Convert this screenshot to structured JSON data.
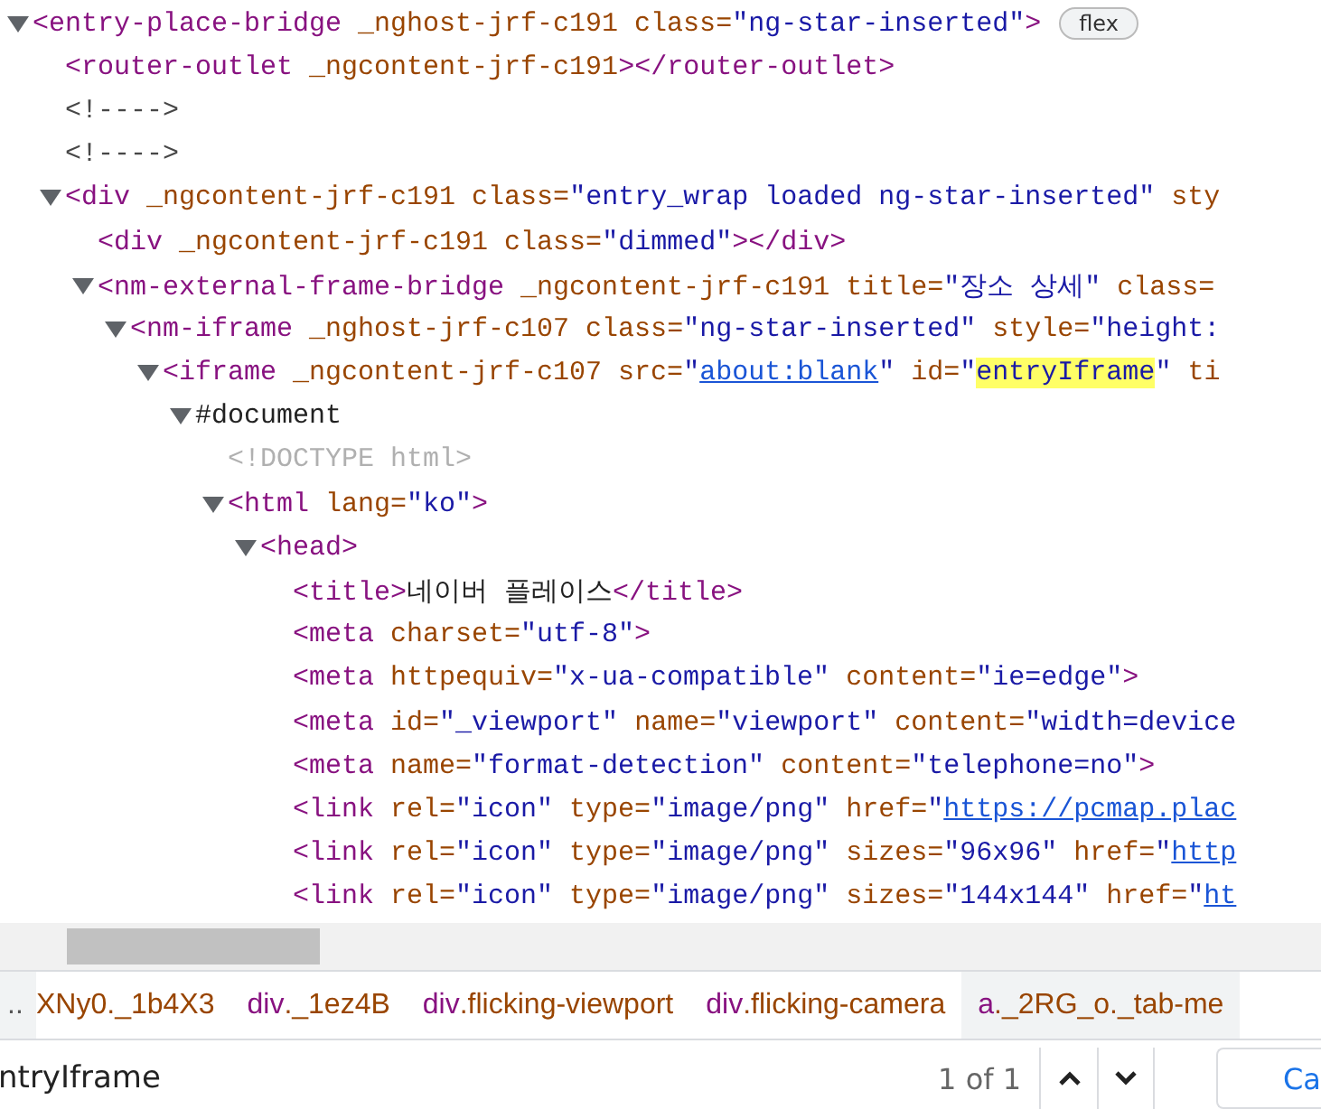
{
  "dom_tree": {
    "nodes": [
      {
        "kind": "parent",
        "expanded": true,
        "tokens": [
          {
            "kind": "tag",
            "text": "<entry-place-bridge "
          },
          {
            "kind": "attr",
            "text": "_nghost-jrf-c191 class="
          },
          {
            "kind": "value",
            "text": "\"ng-star-inserted\""
          },
          {
            "kind": "tag",
            "text": ">"
          }
        ],
        "badge": "flex",
        "children": [
          {
            "kind": "leaf",
            "tokens": [
              {
                "kind": "tag",
                "text": "<router-outlet "
              },
              {
                "kind": "attr",
                "text": "_ngcontent-jrf-c191"
              },
              {
                "kind": "tag",
                "text": "></router-outlet>"
              }
            ]
          },
          {
            "kind": "leaf",
            "tokens": [
              {
                "kind": "comment",
                "text": "<!---->"
              }
            ]
          },
          {
            "kind": "leaf",
            "tokens": [
              {
                "kind": "comment",
                "text": "<!---->"
              }
            ]
          },
          {
            "kind": "parent",
            "expanded": true,
            "tokens": [
              {
                "kind": "tag",
                "text": "<div "
              },
              {
                "kind": "attr",
                "text": "_ngcontent-jrf-c191 class="
              },
              {
                "kind": "value",
                "text": "\"entry_wrap loaded ng-star-inserted\""
              },
              {
                "kind": "attr",
                "text": " sty"
              }
            ],
            "children": [
              {
                "kind": "leaf",
                "tokens": [
                  {
                    "kind": "tag",
                    "text": "<div "
                  },
                  {
                    "kind": "attr",
                    "text": "_ngcontent-jrf-c191 class="
                  },
                  {
                    "kind": "value",
                    "text": "\"dimmed\""
                  },
                  {
                    "kind": "tag",
                    "text": "></div>"
                  }
                ]
              },
              {
                "kind": "parent",
                "expanded": true,
                "tokens": [
                  {
                    "kind": "tag",
                    "text": "<nm-external-frame-bridge "
                  },
                  {
                    "kind": "attr",
                    "text": "_ngcontent-jrf-c191 title="
                  },
                  {
                    "kind": "value",
                    "text": "\"장소 상세\""
                  },
                  {
                    "kind": "attr",
                    "text": " class="
                  }
                ],
                "children": [
                  {
                    "kind": "parent",
                    "expanded": true,
                    "tokens": [
                      {
                        "kind": "tag",
                        "text": "<nm-iframe "
                      },
                      {
                        "kind": "attr",
                        "text": "_nghost-jrf-c107 class="
                      },
                      {
                        "kind": "value",
                        "text": "\"ng-star-inserted\""
                      },
                      {
                        "kind": "attr",
                        "text": " style="
                      },
                      {
                        "kind": "value",
                        "text": "\"height:"
                      }
                    ],
                    "children": [
                      {
                        "kind": "parent",
                        "expanded": true,
                        "tokens": [
                          {
                            "kind": "tag",
                            "text": "<iframe "
                          },
                          {
                            "kind": "attr",
                            "text": "_ngcontent-jrf-c107 src="
                          },
                          {
                            "kind": "value",
                            "text": "\""
                          },
                          {
                            "kind": "link",
                            "text": "about:blank"
                          },
                          {
                            "kind": "value",
                            "text": "\""
                          },
                          {
                            "kind": "attr",
                            "text": " id="
                          },
                          {
                            "kind": "value",
                            "text": "\""
                          },
                          {
                            "kind": "match",
                            "text": "entryIframe"
                          },
                          {
                            "kind": "value",
                            "text": "\""
                          },
                          {
                            "kind": "attr",
                            "text": " ti"
                          }
                        ],
                        "children": [
                          {
                            "kind": "parent",
                            "expanded": true,
                            "tokens": [
                              {
                                "kind": "text",
                                "text": "#document"
                              }
                            ],
                            "children": [
                              {
                                "kind": "leaf",
                                "tokens": [
                                  {
                                    "kind": "doctype",
                                    "text": "<!DOCTYPE html>"
                                  }
                                ]
                              },
                              {
                                "kind": "parent",
                                "expanded": true,
                                "tokens": [
                                  {
                                    "kind": "tag",
                                    "text": "<html "
                                  },
                                  {
                                    "kind": "attr",
                                    "text": "lang="
                                  },
                                  {
                                    "kind": "value",
                                    "text": "\"ko\""
                                  },
                                  {
                                    "kind": "tag",
                                    "text": ">"
                                  }
                                ],
                                "children": [
                                  {
                                    "kind": "parent",
                                    "expanded": true,
                                    "tokens": [
                                      {
                                        "kind": "tag",
                                        "text": "<head>"
                                      }
                                    ],
                                    "children": [
                                      {
                                        "kind": "leaf",
                                        "tokens": [
                                          {
                                            "kind": "tag",
                                            "text": "<title>"
                                          },
                                          {
                                            "kind": "text",
                                            "text": "네이버 플레이스"
                                          },
                                          {
                                            "kind": "tag",
                                            "text": "</title>"
                                          }
                                        ]
                                      },
                                      {
                                        "kind": "leaf",
                                        "tokens": [
                                          {
                                            "kind": "tag",
                                            "text": "<meta "
                                          },
                                          {
                                            "kind": "attr",
                                            "text": "charset="
                                          },
                                          {
                                            "kind": "value",
                                            "text": "\"utf-8\""
                                          },
                                          {
                                            "kind": "tag",
                                            "text": ">"
                                          }
                                        ]
                                      },
                                      {
                                        "kind": "leaf",
                                        "tokens": [
                                          {
                                            "kind": "tag",
                                            "text": "<meta "
                                          },
                                          {
                                            "kind": "attr",
                                            "text": "httpequiv="
                                          },
                                          {
                                            "kind": "value",
                                            "text": "\"x-ua-compatible\""
                                          },
                                          {
                                            "kind": "attr",
                                            "text": " content="
                                          },
                                          {
                                            "kind": "value",
                                            "text": "\"ie=edge\""
                                          },
                                          {
                                            "kind": "tag",
                                            "text": ">"
                                          }
                                        ]
                                      },
                                      {
                                        "kind": "leaf",
                                        "tokens": [
                                          {
                                            "kind": "tag",
                                            "text": "<meta "
                                          },
                                          {
                                            "kind": "attr",
                                            "text": "id="
                                          },
                                          {
                                            "kind": "value",
                                            "text": "\"_viewport\""
                                          },
                                          {
                                            "kind": "attr",
                                            "text": " name="
                                          },
                                          {
                                            "kind": "value",
                                            "text": "\"viewport\""
                                          },
                                          {
                                            "kind": "attr",
                                            "text": " content="
                                          },
                                          {
                                            "kind": "value",
                                            "text": "\"width=device"
                                          }
                                        ]
                                      },
                                      {
                                        "kind": "leaf",
                                        "tokens": [
                                          {
                                            "kind": "tag",
                                            "text": "<meta "
                                          },
                                          {
                                            "kind": "attr",
                                            "text": "name="
                                          },
                                          {
                                            "kind": "value",
                                            "text": "\"format-detection\""
                                          },
                                          {
                                            "kind": "attr",
                                            "text": " content="
                                          },
                                          {
                                            "kind": "value",
                                            "text": "\"telephone=no\""
                                          },
                                          {
                                            "kind": "tag",
                                            "text": ">"
                                          }
                                        ]
                                      },
                                      {
                                        "kind": "leaf",
                                        "tokens": [
                                          {
                                            "kind": "tag",
                                            "text": "<link "
                                          },
                                          {
                                            "kind": "attr",
                                            "text": "rel="
                                          },
                                          {
                                            "kind": "value",
                                            "text": "\"icon\""
                                          },
                                          {
                                            "kind": "attr",
                                            "text": " type="
                                          },
                                          {
                                            "kind": "value",
                                            "text": "\"image/png\""
                                          },
                                          {
                                            "kind": "attr",
                                            "text": " href="
                                          },
                                          {
                                            "kind": "value",
                                            "text": "\""
                                          },
                                          {
                                            "kind": "link",
                                            "text": "https://pcmap.plac"
                                          }
                                        ]
                                      },
                                      {
                                        "kind": "leaf",
                                        "tokens": [
                                          {
                                            "kind": "tag",
                                            "text": "<link "
                                          },
                                          {
                                            "kind": "attr",
                                            "text": "rel="
                                          },
                                          {
                                            "kind": "value",
                                            "text": "\"icon\""
                                          },
                                          {
                                            "kind": "attr",
                                            "text": " type="
                                          },
                                          {
                                            "kind": "value",
                                            "text": "\"image/png\""
                                          },
                                          {
                                            "kind": "attr",
                                            "text": " sizes="
                                          },
                                          {
                                            "kind": "value",
                                            "text": "\"96x96\""
                                          },
                                          {
                                            "kind": "attr",
                                            "text": " href="
                                          },
                                          {
                                            "kind": "value",
                                            "text": "\""
                                          },
                                          {
                                            "kind": "link",
                                            "text": "http"
                                          }
                                        ]
                                      },
                                      {
                                        "kind": "leaf",
                                        "tokens": [
                                          {
                                            "kind": "tag",
                                            "text": "<link "
                                          },
                                          {
                                            "kind": "attr",
                                            "text": "rel="
                                          },
                                          {
                                            "kind": "value",
                                            "text": "\"icon\""
                                          },
                                          {
                                            "kind": "attr",
                                            "text": " type="
                                          },
                                          {
                                            "kind": "value",
                                            "text": "\"image/png\""
                                          },
                                          {
                                            "kind": "attr",
                                            "text": " sizes="
                                          },
                                          {
                                            "kind": "value",
                                            "text": "\"144x144\""
                                          },
                                          {
                                            "kind": "attr",
                                            "text": " href="
                                          },
                                          {
                                            "kind": "value",
                                            "text": "\""
                                          },
                                          {
                                            "kind": "link",
                                            "text": "ht"
                                          }
                                        ]
                                      }
                                    ]
                                  }
                                ]
                              }
                            ]
                          }
                        ]
                      }
                    ]
                  }
                ]
              }
            ]
          }
        ]
      }
    ]
  },
  "breadcrumbs": {
    "overflow": "..",
    "items": [
      {
        "cls": "XNy0._1b4X3",
        "selected": false
      },
      {
        "tag": "div",
        "cls": "._1ez4B",
        "selected": false
      },
      {
        "tag": "div",
        "cls": ".flicking-viewport",
        "selected": false
      },
      {
        "tag": "div",
        "cls": ".flicking-camera",
        "selected": false
      },
      {
        "tag": "a",
        "cls": "._2RG_o._tab-me",
        "selected": true
      }
    ]
  },
  "find_bar": {
    "value": "ntryIframe",
    "count": "1 of 1",
    "cancel": "Ca"
  }
}
